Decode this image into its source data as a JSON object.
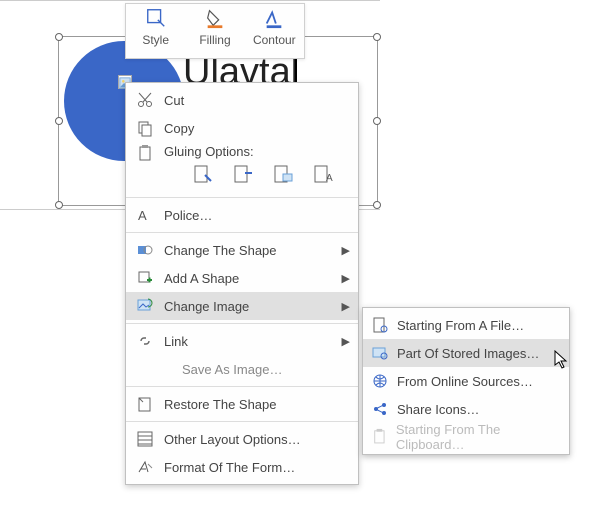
{
  "wordart_text": "Ulavtal",
  "mini_toolbar": {
    "style": "Style",
    "filling": "Filling",
    "contour": "Contour"
  },
  "ctx": {
    "cut": "Cut",
    "copy": "Copy",
    "gluing": "Gluing Options:",
    "police": "Police…",
    "change_shape": "Change The Shape",
    "add_shape": "Add A Shape",
    "change_image": "Change Image",
    "link": "Link",
    "save_as_image": "Save As Image…",
    "restore_shape": "Restore The Shape",
    "other_layout": "Other Layout Options…",
    "format_form": "Format Of The Form…"
  },
  "sub": {
    "from_file": "Starting From A File…",
    "stored_images": "Part Of Stored Images…",
    "online_sources": "From Online Sources…",
    "share_icons": "Share Icons…",
    "from_clipboard": "Starting From The Clipboard…"
  }
}
